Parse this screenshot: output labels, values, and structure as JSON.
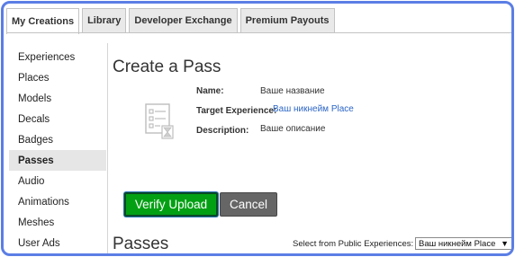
{
  "tabs": [
    {
      "label": "My Creations"
    },
    {
      "label": "Library"
    },
    {
      "label": "Developer Exchange"
    },
    {
      "label": "Premium Payouts"
    }
  ],
  "sidebar": {
    "items": [
      {
        "label": "Experiences"
      },
      {
        "label": "Places"
      },
      {
        "label": "Models"
      },
      {
        "label": "Decals"
      },
      {
        "label": "Badges"
      },
      {
        "label": "Passes"
      },
      {
        "label": "Audio"
      },
      {
        "label": "Animations"
      },
      {
        "label": "Meshes"
      },
      {
        "label": "User Ads"
      }
    ],
    "active": "Passes"
  },
  "main": {
    "title": "Create a Pass",
    "icon": "pass-placeholder-icon",
    "fields": {
      "name_label": "Name:",
      "name_value": "Ваше название",
      "target_label": "Target Experience:",
      "target_value": "Ваш никнейм Place",
      "description_label": "Description:",
      "description_value": "Ваше описание"
    },
    "verify_label": "Verify Upload",
    "cancel_label": "Cancel",
    "passes_title": "Passes",
    "select_label": "Select from Public Experiences:",
    "select_value": "Ваш никнейм Place"
  },
  "colors": {
    "frame_border": "#5b7ee5",
    "verify_button": "#03a014",
    "cancel_button": "#666666",
    "link": "#2b65c6"
  }
}
